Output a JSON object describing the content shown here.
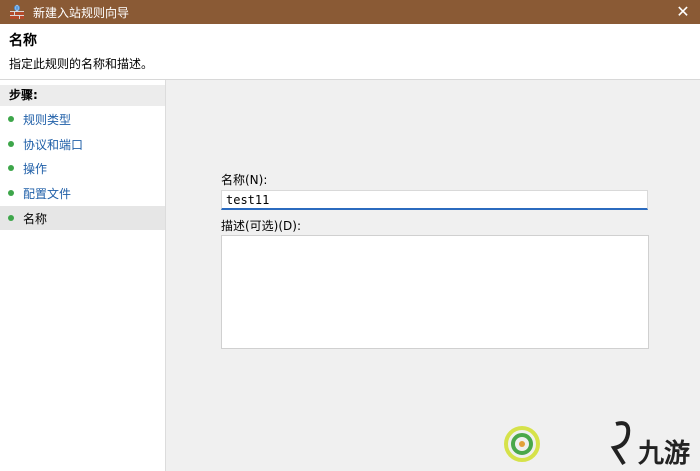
{
  "window": {
    "title": "新建入站规则向导",
    "close_glyph": "✕"
  },
  "header": {
    "title": "名称",
    "description": "指定此规则的名称和描述。"
  },
  "steps": {
    "heading": "步骤:",
    "items": [
      {
        "label": "规则类型"
      },
      {
        "label": "协议和端口"
      },
      {
        "label": "操作"
      },
      {
        "label": "配置文件"
      },
      {
        "label": "名称"
      }
    ],
    "active_index": 4
  },
  "form": {
    "name_label": "名称(N):",
    "name_value": "test11",
    "desc_label": "描述(可选)(D):",
    "desc_value": ""
  },
  "watermark": {
    "text": "九游"
  },
  "colors": {
    "titlebar": "#8a5a35",
    "step_link": "#1f5fa8",
    "step_dot": "#3da64a",
    "input_focus": "#2b6bbf"
  }
}
